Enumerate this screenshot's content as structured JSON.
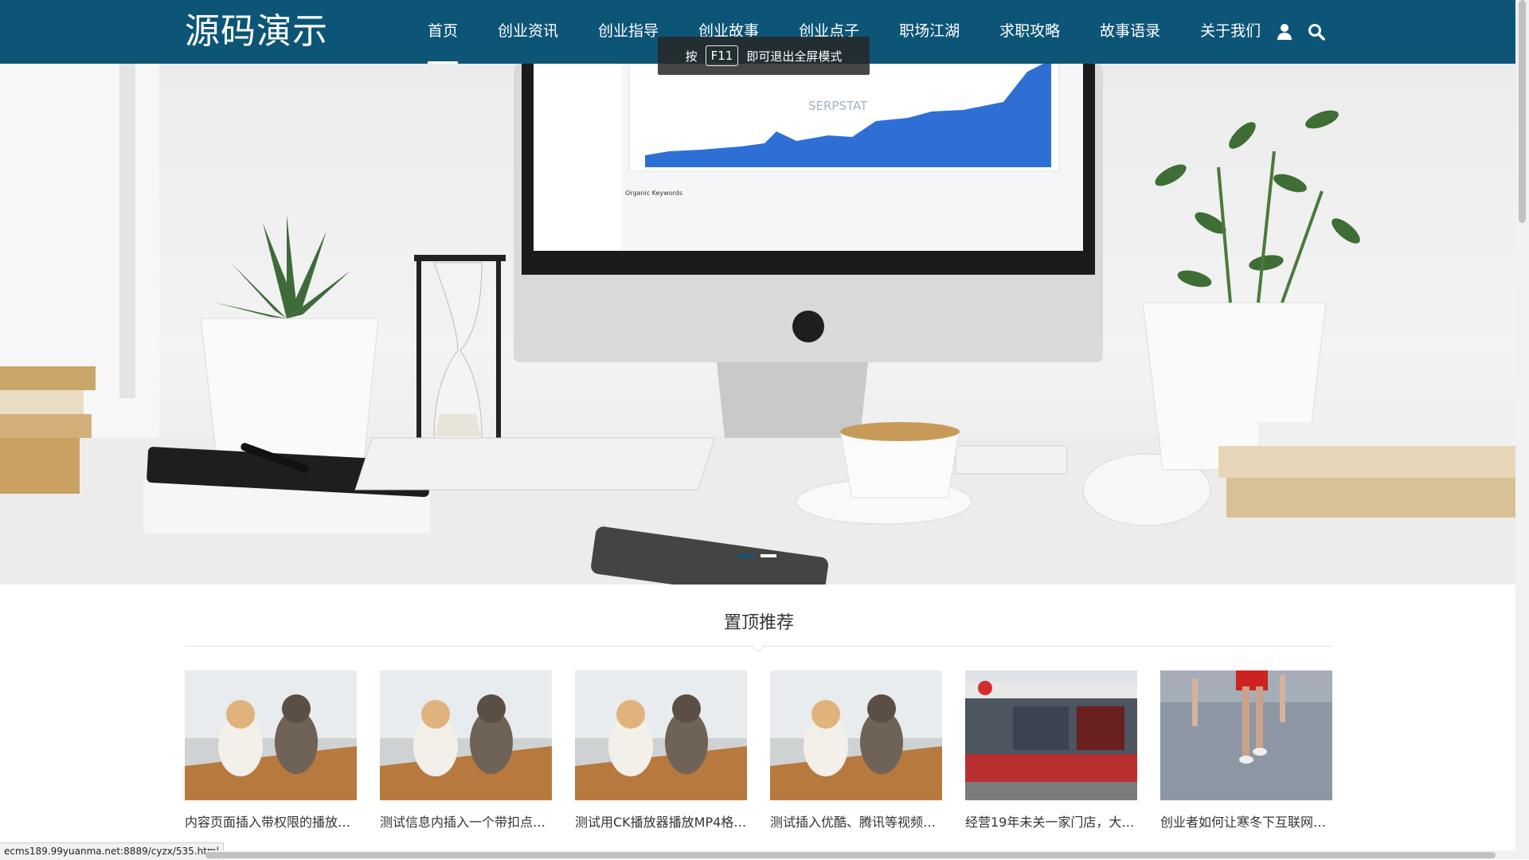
{
  "header": {
    "logo": "源码演示",
    "nav": [
      {
        "label": "首页",
        "active": true
      },
      {
        "label": "创业资讯"
      },
      {
        "label": "创业指导"
      },
      {
        "label": "创业故事"
      },
      {
        "label": "创业点子"
      },
      {
        "label": "职场江湖"
      },
      {
        "label": "求职攻略"
      },
      {
        "label": "故事语录"
      },
      {
        "label": "关于我们"
      }
    ],
    "icons": [
      "user-icon",
      "search-icon"
    ]
  },
  "toast": {
    "prefix": "按",
    "key": "F11",
    "suffix": "即可退出全屏模式"
  },
  "banner": {
    "screen_brand": "SERPSTAT",
    "screen_caption": "Organic Keywords",
    "slide_count": 2,
    "active_slide": 1
  },
  "section": {
    "title": "置顶推荐",
    "cards": [
      {
        "title": "内容页面插入带权限的播放…",
        "thumb": "cats"
      },
      {
        "title": "测试信息内插入一个带扣点…",
        "thumb": "cats"
      },
      {
        "title": "测试用CK播放器播放MP4格…",
        "thumb": "cats"
      },
      {
        "title": "测试插入优酷、腾讯等视频…",
        "thumb": "cats"
      },
      {
        "title": "经营19年未关一家门店，大…",
        "thumb": "store"
      },
      {
        "title": "创业者如何让寒冬下互联网…",
        "thumb": "runners"
      }
    ]
  },
  "status_url": "ecms189.99yuanma.net:8889/cyzx/535.html",
  "colors": {
    "header_bg": "#0d5577",
    "accent": "#0d5577"
  }
}
